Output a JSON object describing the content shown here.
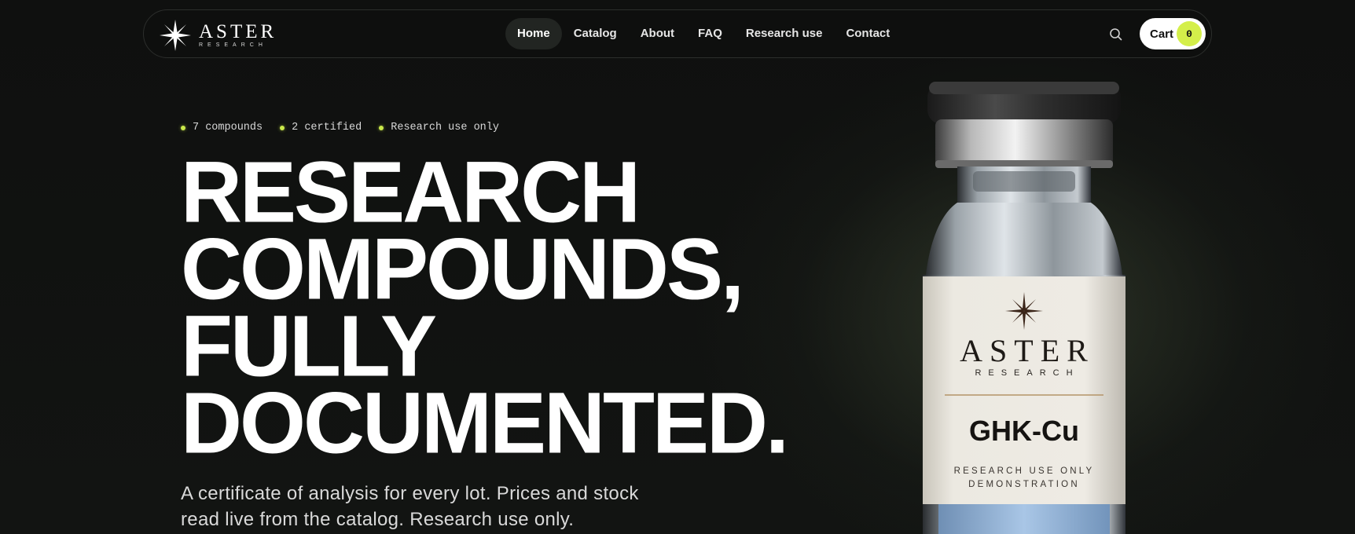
{
  "brand": {
    "name": "ASTER",
    "tagline": "RESEARCH"
  },
  "nav": {
    "items": [
      {
        "label": "Home",
        "active": true
      },
      {
        "label": "Catalog",
        "active": false
      },
      {
        "label": "About",
        "active": false
      },
      {
        "label": "FAQ",
        "active": false
      },
      {
        "label": "Research use",
        "active": false
      },
      {
        "label": "Contact",
        "active": false
      }
    ],
    "search_icon": "search-icon",
    "cart": {
      "label": "Cart",
      "count": "0"
    }
  },
  "hero": {
    "stats": [
      {
        "label": "7 compounds"
      },
      {
        "label": "2 certified"
      },
      {
        "label": "Research use only"
      }
    ],
    "headline_lines": [
      "RESEARCH",
      "COMPOUNDS,",
      "FULLY",
      "DOCUMENTED."
    ],
    "subtext": "A certificate of analysis for every lot. Prices and stock read live from the catalog. Research use only."
  },
  "product_image": {
    "brand": "ASTER",
    "brand_sub": "RESEARCH",
    "product_name": "GHK-Cu",
    "note_line_1": "RESEARCH USE ONLY",
    "note_line_2": "DEMONSTRATION"
  },
  "colors": {
    "background": "#101110",
    "accent": "#d4ef4a",
    "text": "#ffffff"
  }
}
